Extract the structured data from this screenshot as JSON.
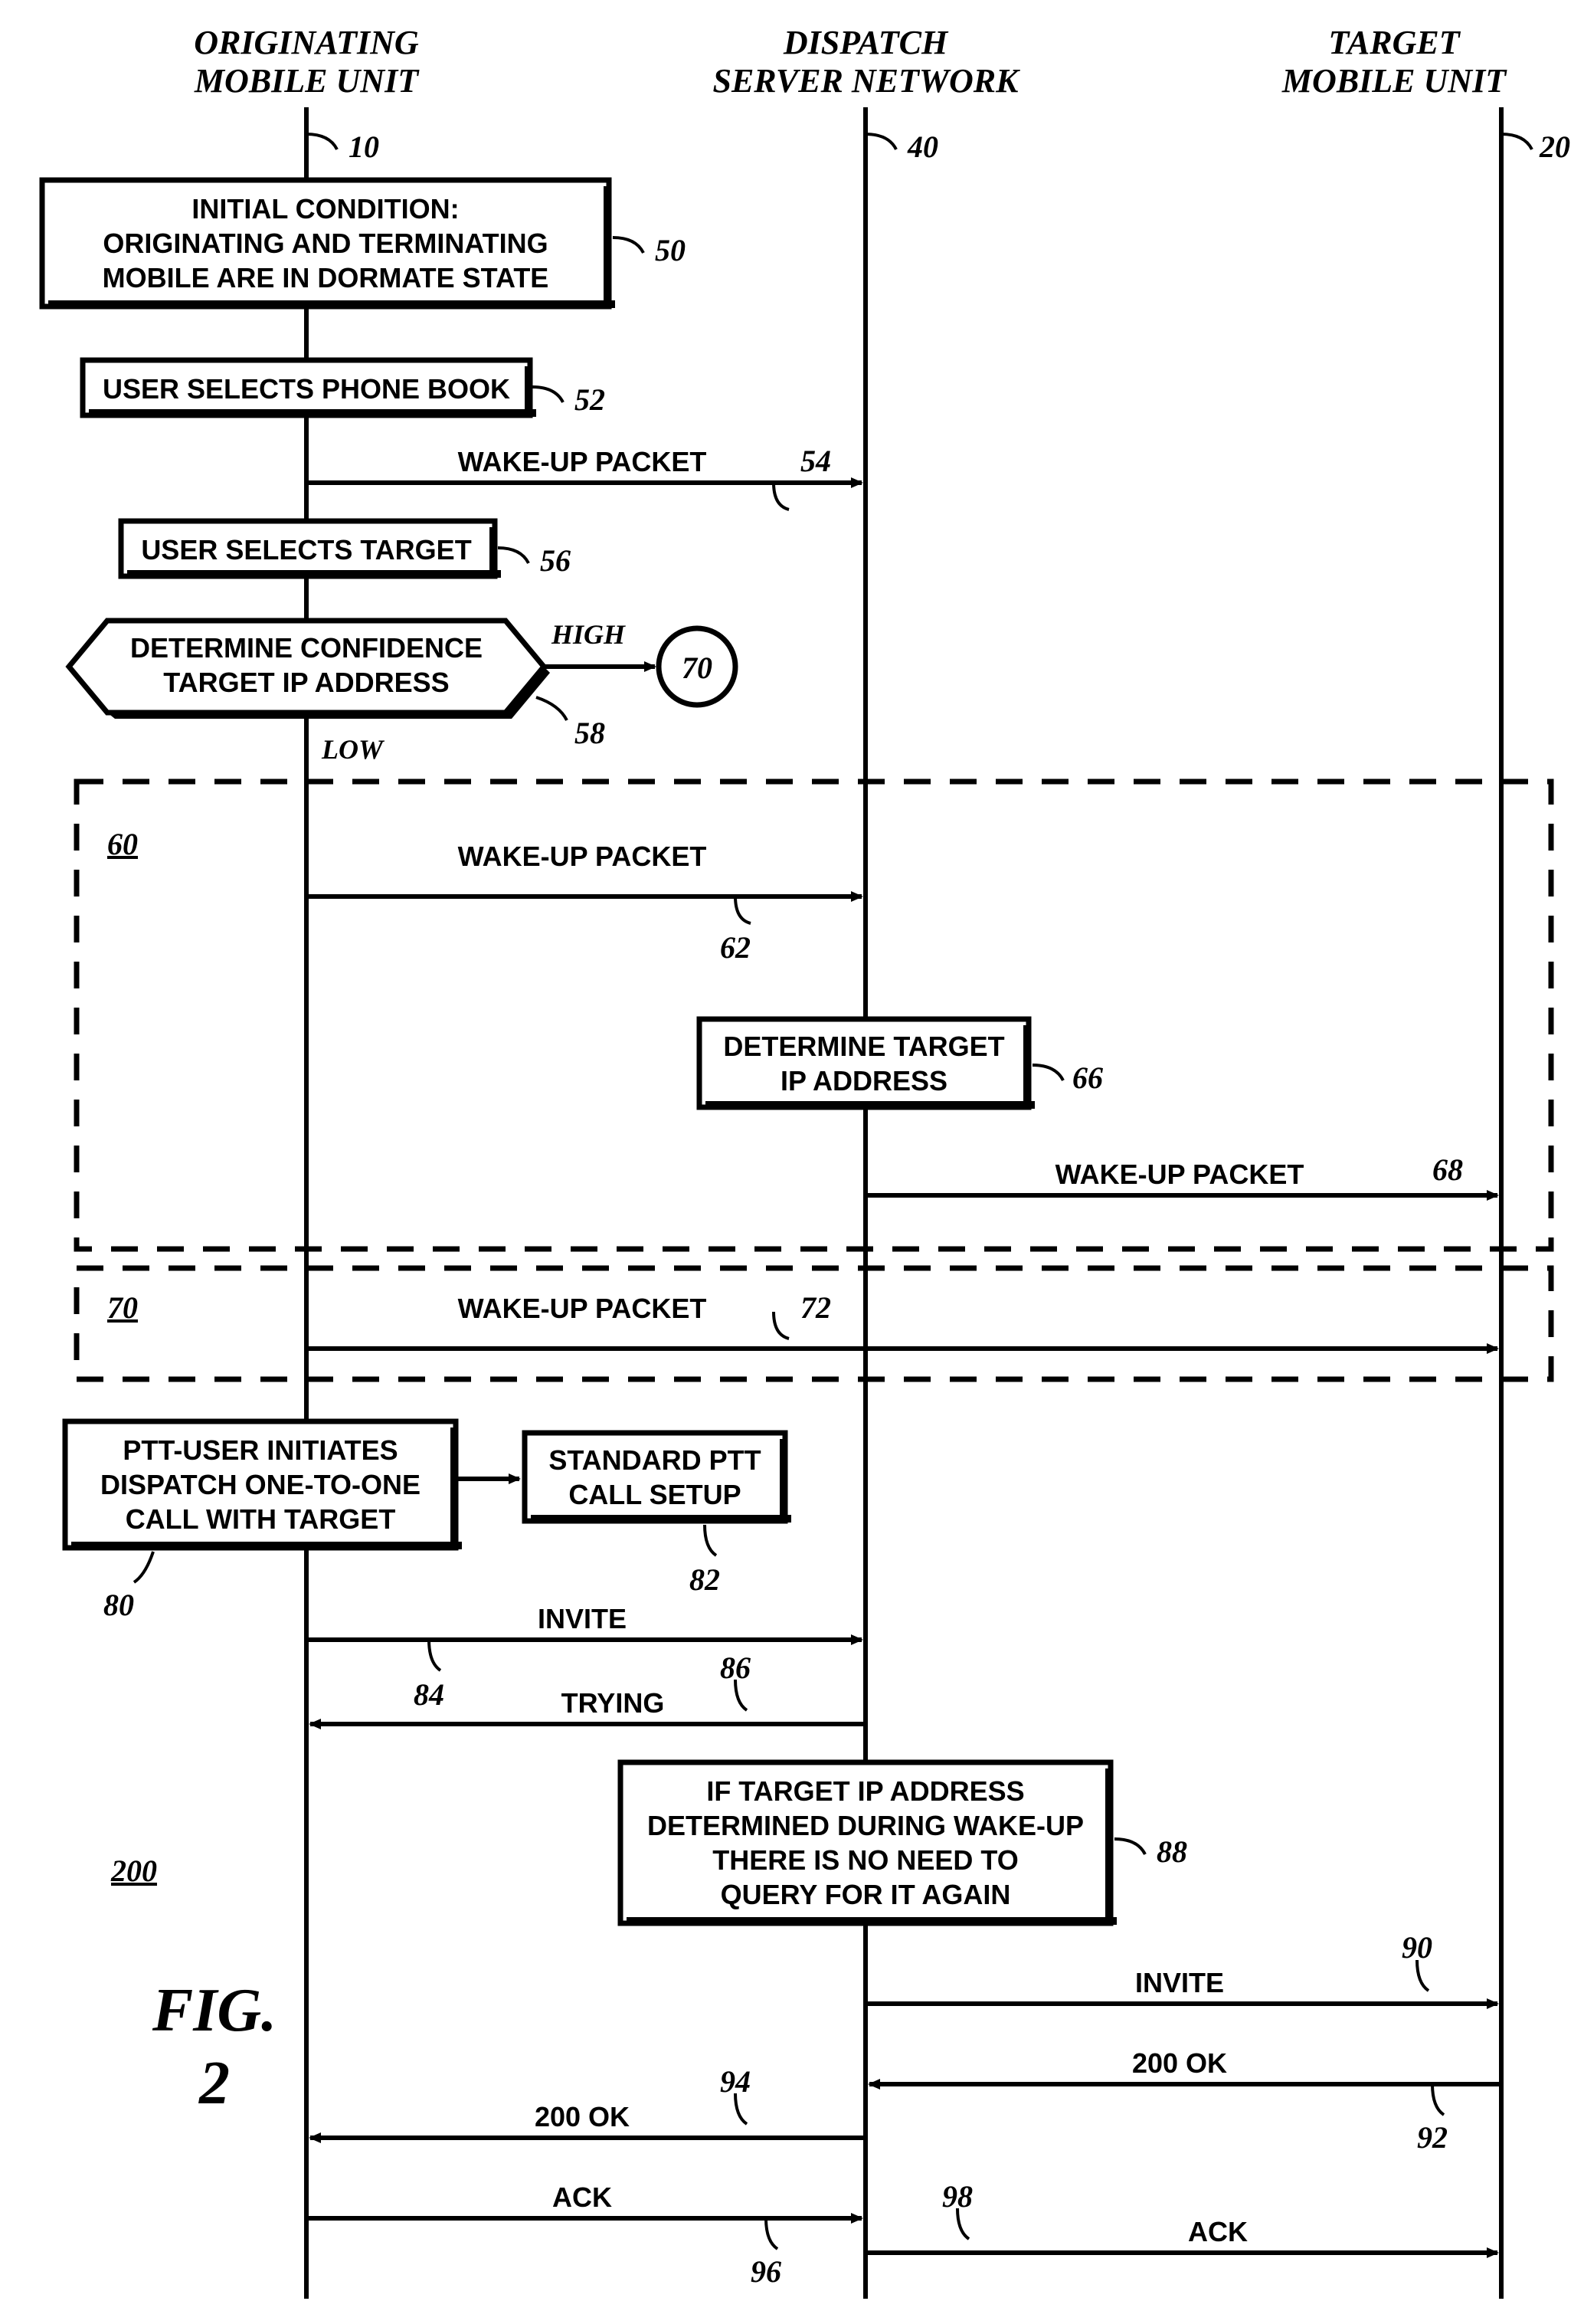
{
  "headers": {
    "orig1": "ORIGINATING",
    "orig2": "MOBILE UNIT",
    "disp1": "DISPATCH",
    "disp2": "SERVER NETWORK",
    "targ1": "TARGET",
    "targ2": "MOBILE UNIT"
  },
  "refs": {
    "r10": "10",
    "r40": "40",
    "r20": "20",
    "r50": "50",
    "r52": "52",
    "r54": "54",
    "r56": "56",
    "r58": "58",
    "r60": "60",
    "r62": "62",
    "r66": "66",
    "r68": "68",
    "r70u": "70",
    "r70": "70",
    "r72": "72",
    "r80": "80",
    "r82": "82",
    "r84": "84",
    "r86": "86",
    "r88": "88",
    "r90": "90",
    "r92": "92",
    "r94": "94",
    "r96": "96",
    "r98": "98",
    "r200": "200"
  },
  "labels": {
    "high": "HIGH",
    "low": "LOW"
  },
  "boxes": {
    "b50a": "INITIAL CONDITION:",
    "b50b": "ORIGINATING AND TERMINATING",
    "b50c": "MOBILE ARE IN DORMATE STATE",
    "b52": "USER SELECTS PHONE BOOK",
    "b56": "USER SELECTS TARGET",
    "b58a": "DETERMINE CONFIDENCE",
    "b58b": "TARGET IP ADDRESS",
    "b66a": "DETERMINE TARGET",
    "b66b": "IP ADDRESS",
    "b80a": "PTT-USER INITIATES",
    "b80b": "DISPATCH ONE-TO-ONE",
    "b80c": "CALL WITH TARGET",
    "b82a": "STANDARD PTT",
    "b82b": "CALL SETUP",
    "b88a": "IF TARGET IP ADDRESS",
    "b88b": "DETERMINED DURING WAKE-UP",
    "b88c": "THERE IS NO NEED TO",
    "b88d": "QUERY FOR IT AGAIN"
  },
  "msgs": {
    "wakeup": "WAKE-UP PACKET",
    "invite": "INVITE",
    "trying": "TRYING",
    "ok200": "200 OK",
    "ack": "ACK"
  },
  "fig": {
    "l1": "FIG.",
    "l2": "2"
  }
}
